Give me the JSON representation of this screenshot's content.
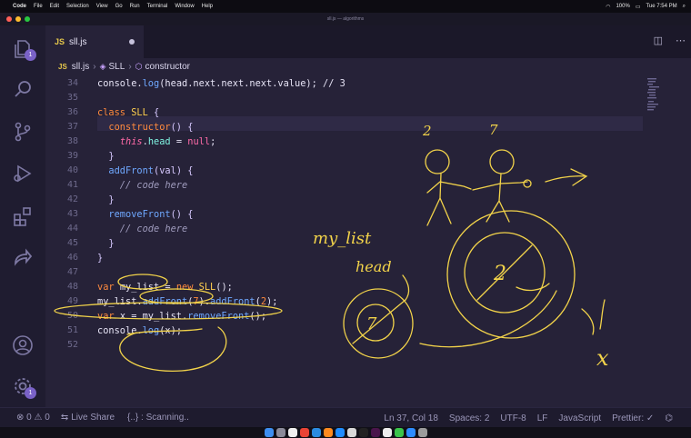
{
  "menubar": {
    "app": "Code",
    "items": [
      "File",
      "Edit",
      "Selection",
      "View",
      "Go",
      "Run",
      "Terminal",
      "Window",
      "Help"
    ],
    "battery": "100%",
    "clock": "Tue 7:54 PM"
  },
  "window": {
    "title": "sll.js — algorithms"
  },
  "tab": {
    "icon": "JS",
    "name": "sll.js"
  },
  "breadcrumb": {
    "icon": "JS",
    "file": "sll.js",
    "cls": "SLL",
    "member": "constructor"
  },
  "badges": {
    "explorer": "1",
    "settings": "1"
  },
  "editor": {
    "lines": [
      {
        "n": "34",
        "tokens": [
          {
            "t": "console.",
            "c": ""
          },
          {
            "t": "log",
            "c": "fn"
          },
          {
            "t": "(head.next.next.next.value); // 3",
            "c": ""
          }
        ]
      },
      {
        "n": "35",
        "tokens": []
      },
      {
        "n": "36",
        "tokens": [
          {
            "t": "class ",
            "c": "kw"
          },
          {
            "t": "SLL",
            "c": "cls"
          },
          {
            "t": " {",
            "c": "br"
          }
        ]
      },
      {
        "n": "37",
        "tokens": [
          {
            "t": "  ",
            "c": ""
          },
          {
            "t": "constructor",
            "c": "kw"
          },
          {
            "t": "() {",
            "c": "br"
          }
        ]
      },
      {
        "n": "38",
        "tokens": [
          {
            "t": "    ",
            "c": ""
          },
          {
            "t": "this",
            "c": "kwi"
          },
          {
            "t": ".",
            "c": ""
          },
          {
            "t": "head",
            "c": "prop"
          },
          {
            "t": " = ",
            "c": ""
          },
          {
            "t": "null",
            "c": "null"
          },
          {
            "t": ";",
            "c": ""
          }
        ]
      },
      {
        "n": "39",
        "tokens": [
          {
            "t": "  }",
            "c": "br"
          }
        ]
      },
      {
        "n": "40",
        "tokens": [
          {
            "t": "  ",
            "c": ""
          },
          {
            "t": "addFront",
            "c": "fn"
          },
          {
            "t": "(val) {",
            "c": "br"
          }
        ]
      },
      {
        "n": "41",
        "tokens": [
          {
            "t": "    // code here",
            "c": "cm"
          }
        ]
      },
      {
        "n": "42",
        "tokens": [
          {
            "t": "  }",
            "c": "br"
          }
        ]
      },
      {
        "n": "43",
        "tokens": [
          {
            "t": "  ",
            "c": ""
          },
          {
            "t": "removeFront",
            "c": "fn"
          },
          {
            "t": "() {",
            "c": "br"
          }
        ]
      },
      {
        "n": "44",
        "tokens": [
          {
            "t": "    // code here",
            "c": "cm"
          }
        ]
      },
      {
        "n": "45",
        "tokens": [
          {
            "t": "  }",
            "c": "br"
          }
        ]
      },
      {
        "n": "46",
        "tokens": [
          {
            "t": "}",
            "c": "br"
          }
        ]
      },
      {
        "n": "47",
        "tokens": []
      },
      {
        "n": "48",
        "tokens": [
          {
            "t": "var ",
            "c": "kw"
          },
          {
            "t": "my_list",
            "c": ""
          },
          {
            "t": " = ",
            "c": ""
          },
          {
            "t": "new ",
            "c": "kw"
          },
          {
            "t": "SLL",
            "c": "cls"
          },
          {
            "t": "();",
            "c": ""
          }
        ]
      },
      {
        "n": "49",
        "tokens": [
          {
            "t": "my_list.",
            "c": ""
          },
          {
            "t": "addFront",
            "c": "fn"
          },
          {
            "t": "(",
            "c": ""
          },
          {
            "t": "7",
            "c": "kw"
          },
          {
            "t": ").",
            "c": ""
          },
          {
            "t": "addFront",
            "c": "fn"
          },
          {
            "t": "(",
            "c": ""
          },
          {
            "t": "2",
            "c": "kw"
          },
          {
            "t": ");",
            "c": ""
          }
        ]
      },
      {
        "n": "50",
        "tokens": [
          {
            "t": "var ",
            "c": "kw"
          },
          {
            "t": "x = my_list.",
            "c": ""
          },
          {
            "t": "removeFront",
            "c": "fn"
          },
          {
            "t": "();",
            "c": ""
          }
        ]
      },
      {
        "n": "51",
        "tokens": [
          {
            "t": "console.",
            "c": ""
          },
          {
            "t": "log",
            "c": "fn"
          },
          {
            "t": "(x);",
            "c": ""
          }
        ]
      },
      {
        "n": "52",
        "tokens": []
      }
    ]
  },
  "annotations": {
    "people_left": "2",
    "people_right": "7",
    "label1": "my_list",
    "label2": "head",
    "node_big": "2",
    "node_small": "7",
    "x_mark": "x"
  },
  "status": {
    "problems": "⊗ 0 ⚠ 0",
    "live_share": "Live Share",
    "scanning": "{..} : Scanning..",
    "position": "Ln 37, Col 18",
    "spaces": "Spaces: 2",
    "encoding": "UTF-8",
    "eol": "LF",
    "language": "JavaScript",
    "prettier": "Prettier: ✓"
  },
  "colors": {
    "ink": "#f2d34a",
    "accent": "#7a62c7"
  }
}
